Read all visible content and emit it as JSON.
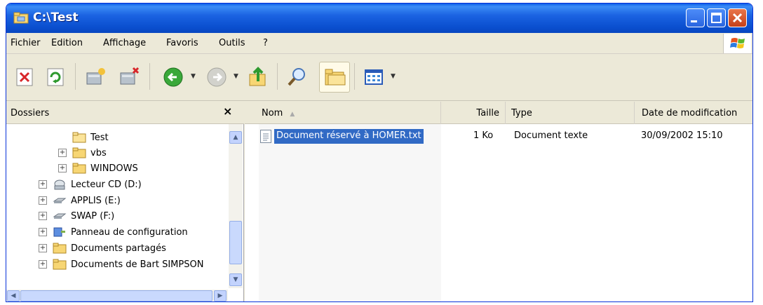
{
  "window": {
    "title": "C:\\Test"
  },
  "menu": [
    "Fichier",
    "Edition",
    "Affichage",
    "Favoris",
    "Outils",
    "?"
  ],
  "toolbar": {
    "tools": [
      "delete-icon",
      "refresh-icon",
      "map-drive-icon",
      "disconnect-drive-icon",
      "back-icon",
      "forward-icon",
      "up-folder-icon",
      "search-icon",
      "folders-icon",
      "views-icon"
    ]
  },
  "folders": {
    "header": "Dossiers",
    "close": "×",
    "items": [
      {
        "label": "Test",
        "expander": ""
      },
      {
        "label": "vbs",
        "expander": "+"
      },
      {
        "label": "WINDOWS",
        "expander": "+"
      },
      {
        "label": "Lecteur CD (D:)",
        "expander": "+"
      },
      {
        "label": "APPLIS (E:)",
        "expander": "+"
      },
      {
        "label": "SWAP (F:)",
        "expander": "+"
      },
      {
        "label": "Panneau de configuration",
        "expander": "+"
      },
      {
        "label": "Documents partagés",
        "expander": "+"
      },
      {
        "label": "Documents de Bart SIMPSON",
        "expander": "+"
      }
    ]
  },
  "columns": {
    "name": "Nom",
    "size": "Taille",
    "type": "Type",
    "date": "Date de modification"
  },
  "files": [
    {
      "name": "Document réservé à HOMER.txt",
      "size": "1 Ko",
      "type": "Document texte",
      "date": "30/09/2002 15:10"
    }
  ],
  "colors": {
    "title_blue": "#0a4fcf",
    "selection": "#316ac5",
    "chrome": "#ece9d8"
  }
}
